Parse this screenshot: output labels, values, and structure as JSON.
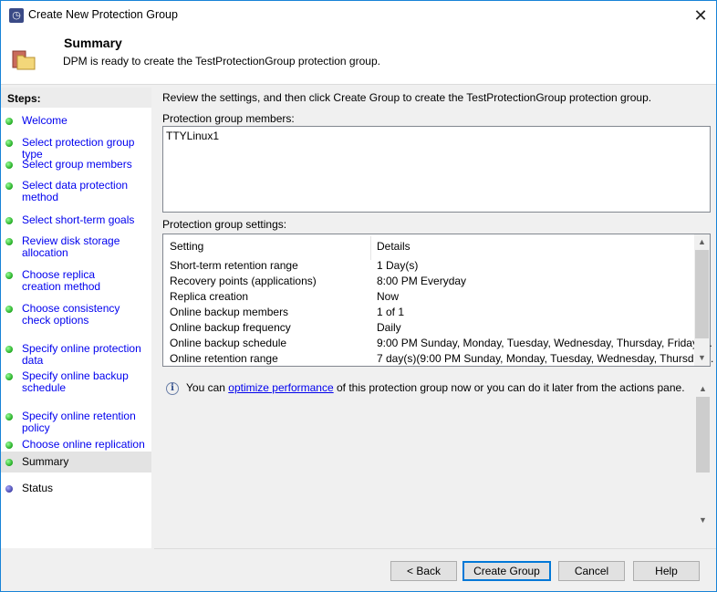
{
  "window": {
    "title": "Create New Protection Group",
    "close": "✕"
  },
  "header": {
    "title": "Summary",
    "subtitle": "DPM is ready to create the TestProtectionGroup protection group."
  },
  "steps": {
    "heading": "Steps:",
    "items": [
      {
        "label": "Welcome",
        "state": "done"
      },
      {
        "label": "Select protection group type",
        "state": "done"
      },
      {
        "label": "Select group members",
        "state": "done"
      },
      {
        "label": "Select data protection method",
        "state": "done"
      },
      {
        "label": "Select short-term goals",
        "state": "done"
      },
      {
        "label": "Review disk storage allocation",
        "state": "done"
      },
      {
        "label": "Choose replica creation method",
        "state": "done"
      },
      {
        "label": "Choose consistency check options",
        "state": "done"
      },
      {
        "label": "Specify online protection data",
        "state": "done"
      },
      {
        "label": "Specify online backup schedule",
        "state": "done"
      },
      {
        "label": "Specify online retention policy",
        "state": "done"
      },
      {
        "label": "Choose online replication",
        "state": "done"
      },
      {
        "label": "Summary",
        "state": "selected"
      },
      {
        "label": "Status",
        "state": "pending"
      }
    ]
  },
  "main": {
    "review": "Review the settings, and then click Create Group to create the TestProtectionGroup protection group.",
    "members_label": "Protection group members:",
    "members": "TTYLinux1",
    "settings_label": "Protection group settings:",
    "columns": [
      "Setting",
      "Details"
    ],
    "rows": [
      [
        "Short-term retention range",
        "1 Day(s)"
      ],
      [
        "Recovery points (applications)",
        "8:00 PM Everyday"
      ],
      [
        "Replica creation",
        "Now"
      ],
      [
        "Online backup members",
        "1 of 1"
      ],
      [
        "Online backup frequency",
        "Daily"
      ],
      [
        "Online backup schedule",
        "9:00 PM Sunday, Monday, Tuesday, Wednesday, Thursday, Friday, ..."
      ],
      [
        "Online retention range",
        "7 day(s)(9:00 PM Sunday, Monday, Tuesday, Wednesday, Thursday..."
      ]
    ],
    "info_pre": "You can ",
    "info_link": "optimize performance",
    "info_post": " of this protection group now or you can do it later from the actions pane."
  },
  "buttons": {
    "back": "< Back",
    "create": "Create Group",
    "cancel": "Cancel",
    "help": "Help"
  }
}
